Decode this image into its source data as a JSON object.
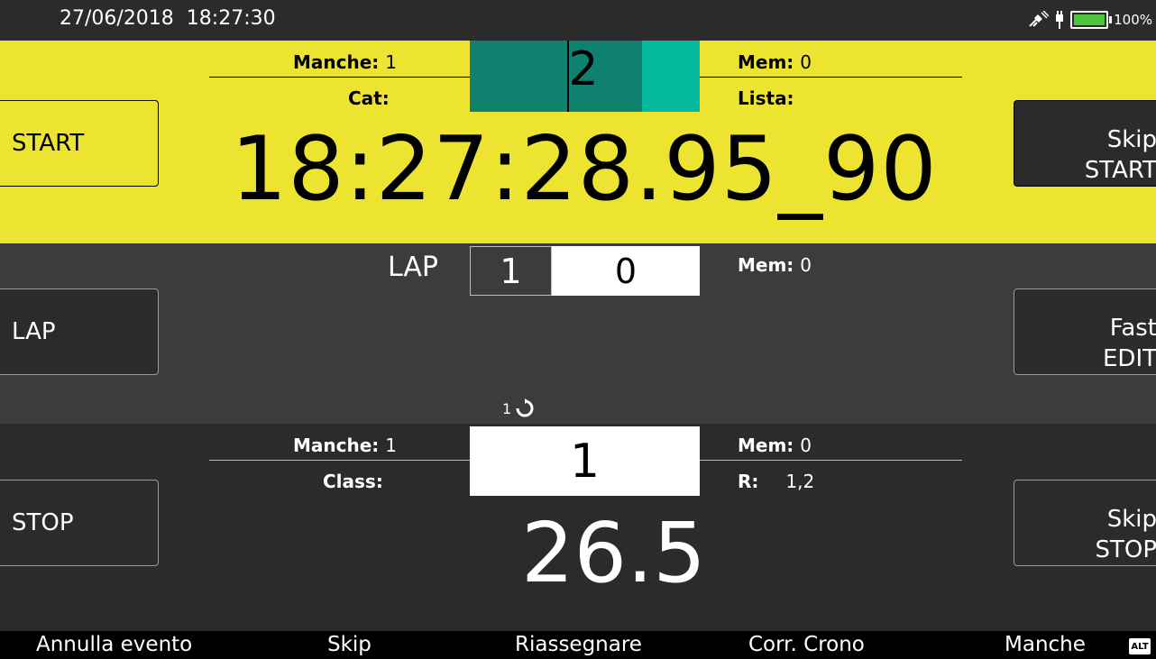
{
  "status_bar": {
    "datetime": "27/06/2018  18:27:30",
    "battery": "100%",
    "icons": [
      "satellite-off-icon",
      "plug-icon",
      "battery-icon"
    ]
  },
  "start_panel": {
    "manche_label": "Manche:",
    "manche_value": "1",
    "cat_label": "Cat:",
    "mem_label": "Mem:",
    "mem_value": "0",
    "lista_label": "Lista:",
    "channel": "2",
    "time": "18:27:28.95_90",
    "button_label": "START",
    "skip_line1": "Skip",
    "skip_line2": "START"
  },
  "lap_panel": {
    "lap_label": "LAP",
    "lap_index": "1",
    "lap_value": "0",
    "mem_label": "Mem:",
    "mem_value": "0",
    "button_label": "LAP",
    "edit_line1": "Fast",
    "edit_line2": "EDIT",
    "loop_count": "1"
  },
  "stop_panel": {
    "manche_label": "Manche:",
    "manche_value": "1",
    "class_label": "Class:",
    "mem_label": "Mem:",
    "mem_value": "0",
    "r_label": "R:",
    "r_value": "1,2",
    "channel": "1",
    "time": "26.5",
    "button_label": "STOP",
    "skip_line1": "Skip",
    "skip_line2": "STOP"
  },
  "function_keys": [
    "Annulla evento",
    "Skip",
    "Riassegnare",
    "Corr. Crono",
    "Manche"
  ],
  "alt_badge": "ALT",
  "colors": {
    "start_bg": "#ede432",
    "lap_bg": "#3c3c3c",
    "stop_bg": "#2b2b2b",
    "teal_dark": "#0e8170",
    "teal_light": "#05b99c"
  }
}
